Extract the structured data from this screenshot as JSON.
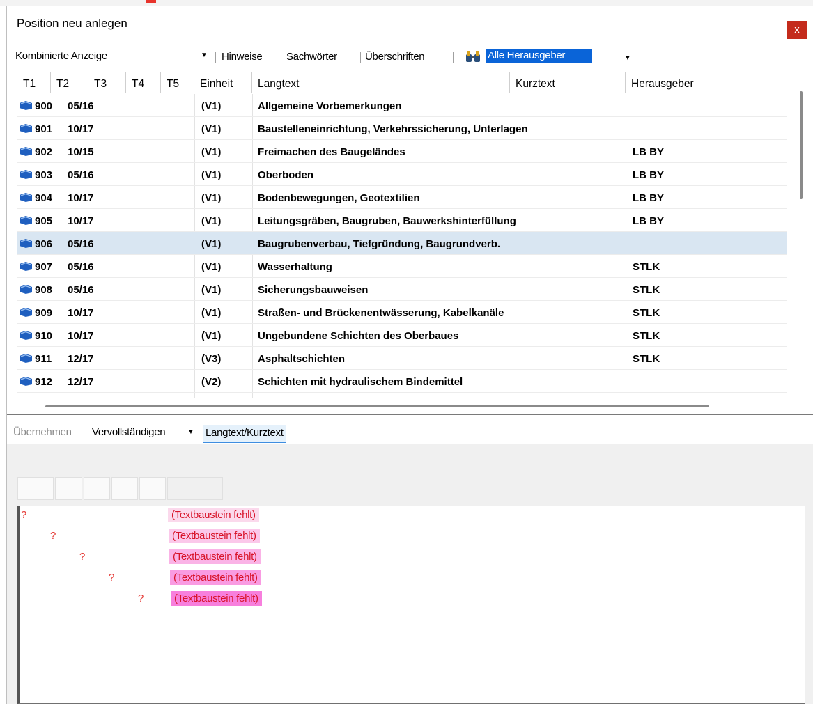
{
  "window": {
    "title": "Position neu anlegen",
    "close_label": "x"
  },
  "toolbar": {
    "view_select": "Kombinierte Anzeige",
    "links": [
      "Hinweise",
      "Sachwörter",
      "Überschriften"
    ],
    "publisher_select": "Alle Herausgeber",
    "binoculars_icon": "binoculars-icon"
  },
  "grid": {
    "columns": [
      "T1",
      "T2",
      "T3",
      "T4",
      "T5",
      "Einheit",
      "Langtext",
      "Kurztext",
      "Herausgeber"
    ],
    "rows": [
      {
        "t1": "900",
        "t2": "05/16",
        "unit": "(V1)",
        "langtext": "Allgemeine Vorbemerkungen",
        "publisher": ""
      },
      {
        "t1": "901",
        "t2": "10/17",
        "unit": "(V1)",
        "langtext": "Baustelleneinrichtung,  Verkehrssicherung,  Unterlagen",
        "publisher": ""
      },
      {
        "t1": "902",
        "t2": "10/15",
        "unit": "(V1)",
        "langtext": "Freimachen des Baugeländes",
        "publisher": "LB BY"
      },
      {
        "t1": "903",
        "t2": "05/16",
        "unit": "(V1)",
        "langtext": "Oberboden",
        "publisher": "LB BY"
      },
      {
        "t1": "904",
        "t2": "10/17",
        "unit": "(V1)",
        "langtext": "Bodenbewegungen, Geotextilien",
        "publisher": "LB BY"
      },
      {
        "t1": "905",
        "t2": "10/17",
        "unit": "(V1)",
        "langtext": "Leitungsgräben, Baugruben, Bauwerkshinterfüllung",
        "publisher": "LB BY"
      },
      {
        "t1": "906",
        "t2": "05/16",
        "unit": "(V1)",
        "langtext": "Baugrubenverbau, Tiefgründung, Baugrundverb.",
        "publisher": ""
      },
      {
        "t1": "907",
        "t2": "05/16",
        "unit": "(V1)",
        "langtext": "Wasserhaltung",
        "publisher": "STLK"
      },
      {
        "t1": "908",
        "t2": "05/16",
        "unit": "(V1)",
        "langtext": "Sicherungsbauweisen",
        "publisher": "STLK"
      },
      {
        "t1": "909",
        "t2": "10/17",
        "unit": "(V1)",
        "langtext": "Straßen- und Brückenentwässerung, Kabelkanäle",
        "publisher": "STLK"
      },
      {
        "t1": "910",
        "t2": "10/17",
        "unit": "(V1)",
        "langtext": "Ungebundene Schichten des Oberbaues",
        "publisher": "STLK"
      },
      {
        "t1": "911",
        "t2": "12/17",
        "unit": "(V3)",
        "langtext": "Asphaltschichten",
        "publisher": "STLK"
      },
      {
        "t1": "912",
        "t2": "12/17",
        "unit": "(V2)",
        "langtext": "Schichten mit hydraulischem Bindemittel",
        "publisher": ""
      }
    ],
    "selected_index": 6,
    "row_icon": "book-icon",
    "icon_color": "#1f5fbf",
    "selection_color": "#d9e6f2"
  },
  "lower_toolbar": {
    "apply_label": "Übernehmen",
    "complete_label": "Vervollständigen",
    "toggle_label": "Langtext/Kurztext"
  },
  "text_blocks": {
    "marker": "?",
    "missing_label": "(Textbaustein fehlt)",
    "levels": 5,
    "colors": [
      "#fbd9ec",
      "#fbc8ea",
      "#fab3e6",
      "#f99be2",
      "#f77fdd"
    ]
  }
}
